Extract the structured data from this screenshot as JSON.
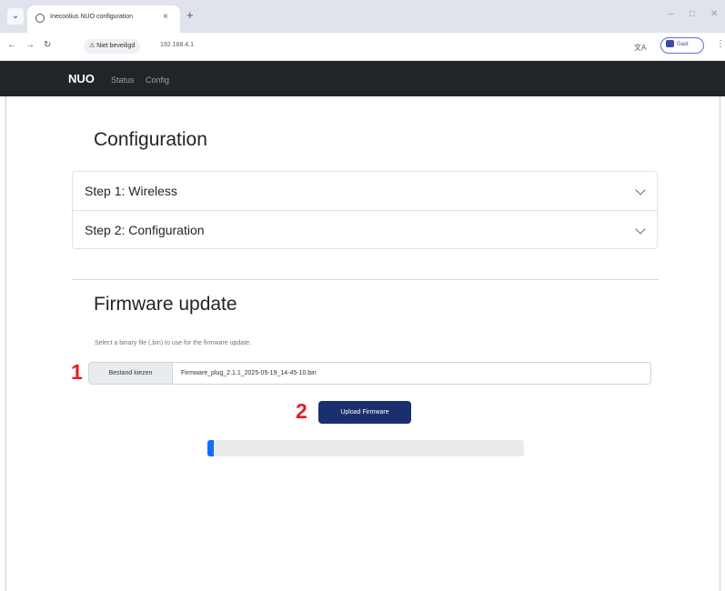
{
  "browser": {
    "tab_title": "Inecoolius NUO configuration",
    "tab_close": "×",
    "new_tab": "+",
    "menu_icon": "⌄",
    "security_badge": "⚠ Niet beveiligd",
    "url": "192.168.4.1",
    "guest_label": "Gast",
    "window_min": "–",
    "window_max": "□",
    "window_close": "✕",
    "back": "←",
    "forward": "→",
    "reload": "↻",
    "translate_icon": "文A",
    "kebab": "⋮"
  },
  "navbar": {
    "brand": "NUO",
    "links": [
      "Status",
      "Config"
    ]
  },
  "configuration": {
    "heading": "Configuration",
    "steps": [
      "Step 1: Wireless",
      "Step 2: Configuration"
    ]
  },
  "firmware": {
    "heading": "Firmware update",
    "help": "Select a binary file (.bin) to use for the firmware update.",
    "file_button": "Bestand kiezen",
    "file_name": "Firmware_plug_2.1.1_2025-05-19_14-45-10.bin",
    "upload_button": "Upload Firmware",
    "progress": 0.01
  },
  "markers": {
    "one": "1",
    "two": "2"
  },
  "colors": {
    "navbar": "#212529",
    "primary_button": "#1a2f6d",
    "progress_fill": "#0d6efd",
    "marker_red": "#e21e26"
  }
}
